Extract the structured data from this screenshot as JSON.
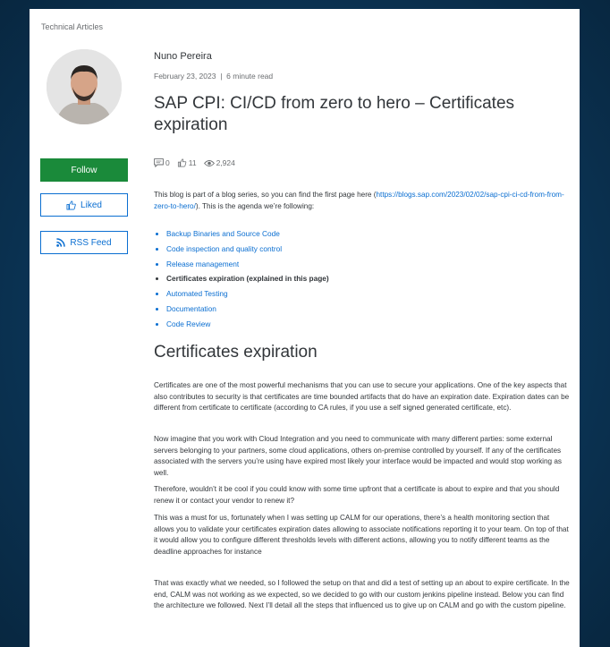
{
  "category": "Technical Articles",
  "sidebar": {
    "follow_label": "Follow",
    "liked_label": "Liked",
    "rss_label": "RSS Feed"
  },
  "article": {
    "author": "Nuno Pereira",
    "date": "February 23, 2023",
    "separator": "|",
    "read_time": "6 minute read",
    "title": "SAP CPI: CI/CD from zero to hero – Certificates expiration",
    "stats": {
      "comments": "0",
      "likes": "11",
      "views": "2,924"
    },
    "intro_before": "This blog is part of a blog series, so you can find the first page here (",
    "intro_link": "https://blogs.sap.com/2023/02/02/sap-cpi-ci-cd-from-from-zero-to-hero/",
    "intro_after": "). This is the agenda we’re following:",
    "agenda": [
      "Backup Binaries and Source Code",
      "Code inspection and quality control",
      "Release management",
      "Certificates expiration (explained in this page)",
      "Automated Testing",
      "Documentation",
      "Code Review"
    ],
    "section_heading": "Certificates expiration",
    "paragraphs": [
      "Certificates are one of the most powerful mechanisms that you can use to secure your applications. One of the key aspects that also contributes to security is that certificates are time bounded artifacts that do have an expiration date. Expiration dates can be different from certificate to certificate (according to CA rules, if you use a self signed generated certificate, etc).",
      "Now imagine that you work with Cloud Integration and you need to communicate with many different parties: some external servers belonging to your partners, some cloud applications, others on-premise controlled by yourself. If any of the certificates associated with the servers you’re using have expired most likely your interface would be impacted and would stop working as well.",
      "Therefore, wouldn’t it be cool if you could know with some time upfront that a certificate is about to expire and that you should renew it or contact your vendor to renew it?",
      "This was a must for us, fortunately when I was setting up CALM for our operations, there’s a health monitoring section that allows you to validate your certificates expiration dates allowing to associate notifications reporting it to your team. On top of that it would allow you to configure different thresholds levels with different actions, allowing you to notify different teams as the deadline approaches for instance",
      "That was exactly what we needed, so I followed the setup on that and did a test of setting up an about to expire certificate. In the end, CALM was not working as we expected, so we decided to go with our custom jenkins pipeline instead. Below you can find the architecture we followed. Next I’ll detail all the steps that influenced us to give up on CALM and go with the custom pipeline."
    ]
  },
  "colors": {
    "follow_bg": "#1a8a3a",
    "link": "#0a6ed1",
    "backdrop": "#0d3b5c"
  }
}
